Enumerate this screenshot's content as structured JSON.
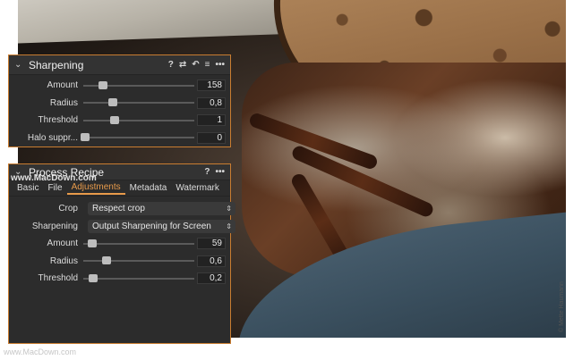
{
  "sharpening": {
    "title": "Sharpening",
    "header_icons": [
      "?",
      "⇄",
      "↶",
      "≡",
      "•••"
    ],
    "rows": [
      {
        "label": "Amount",
        "value": "158",
        "level": 0.18
      },
      {
        "label": "Radius",
        "value": "0,8",
        "level": 0.27
      },
      {
        "label": "Threshold",
        "value": "1",
        "level": 0.28
      },
      {
        "label": "Halo suppr...",
        "value": "0",
        "level": 0.02
      }
    ]
  },
  "recipe": {
    "title": "Process Recipe",
    "header_icons": [
      "?",
      "•••"
    ],
    "tabs": [
      "Basic",
      "File",
      "Adjustments",
      "Metadata",
      "Watermark"
    ],
    "active_tab": "Adjustments",
    "crop": {
      "label": "Crop",
      "value": "Respect crop"
    },
    "sharpening": {
      "label": "Sharpening",
      "value": "Output Sharpening for Screen"
    },
    "rows": [
      {
        "label": "Amount",
        "value": "59",
        "level": 0.08
      },
      {
        "label": "Radius",
        "value": "0,6",
        "level": 0.21
      },
      {
        "label": "Threshold",
        "value": "0,2",
        "level": 0.09
      }
    ]
  },
  "watermark": {
    "panel": "www.MacDown.com",
    "footer": "www.MacDown.com"
  },
  "photo_credit": "© Mette Haumann",
  "colors": {
    "accent": "#e79a4a",
    "panel_border": "#c97d31",
    "panel_bg": "#2c2c2c"
  }
}
